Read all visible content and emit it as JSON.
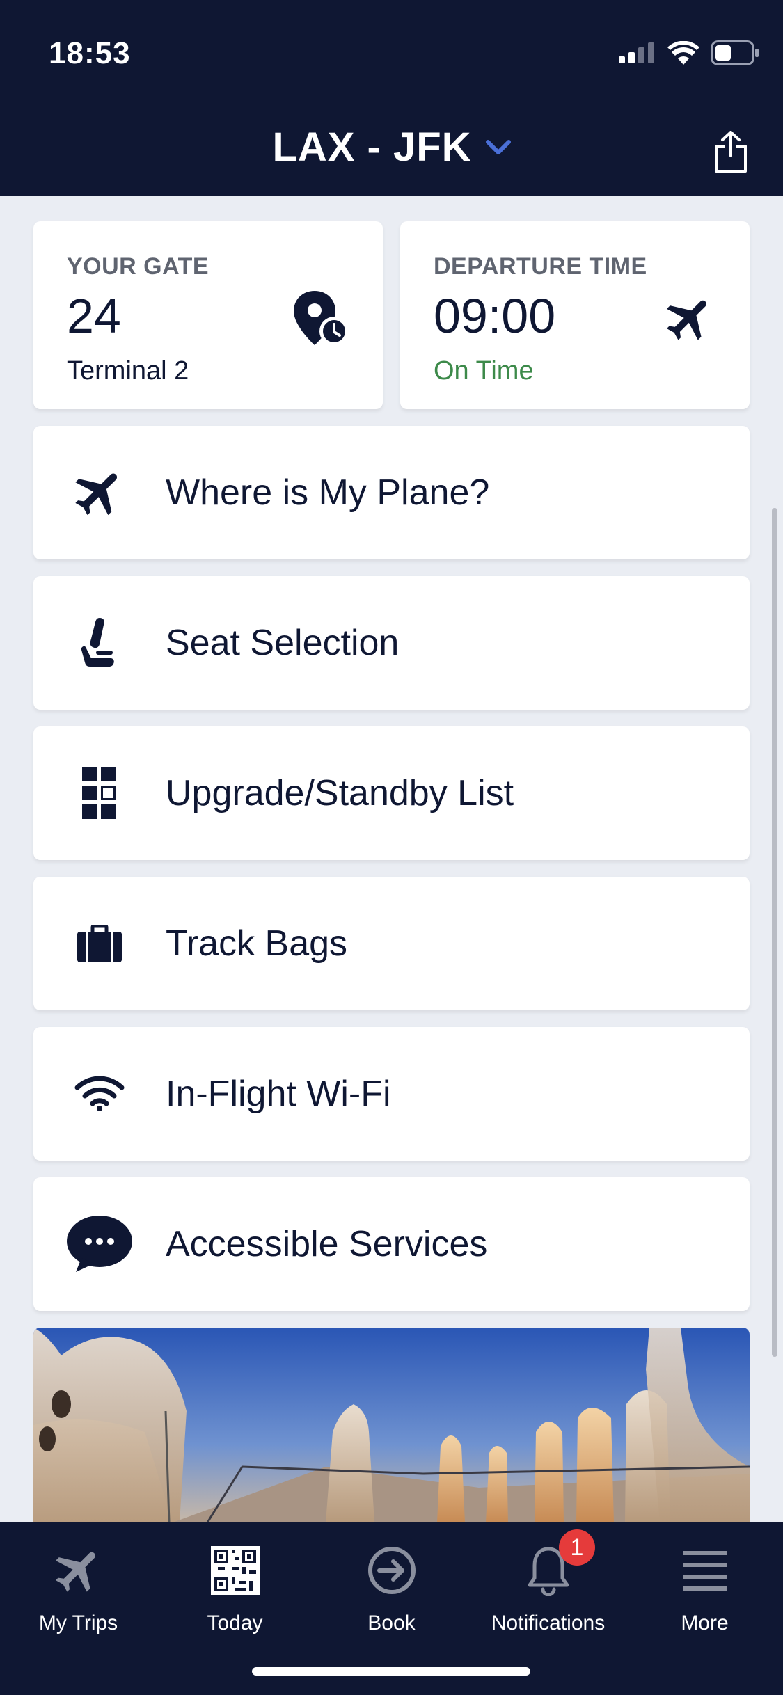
{
  "status_bar": {
    "time": "18:53"
  },
  "header": {
    "title": "LAX - JFK"
  },
  "gate_card": {
    "label": "YOUR GATE",
    "value": "24",
    "sub": "Terminal 2"
  },
  "departure_card": {
    "label": "DEPARTURE TIME",
    "value": "09:00",
    "status": "On Time",
    "status_color": "#3d8a4a"
  },
  "menu": [
    {
      "label": "Where is My Plane?",
      "icon": "plane-icon"
    },
    {
      "label": "Seat Selection",
      "icon": "seat-icon"
    },
    {
      "label": "Upgrade/Standby List",
      "icon": "list-grid-icon"
    },
    {
      "label": "Track Bags",
      "icon": "luggage-icon"
    },
    {
      "label": "In-Flight Wi-Fi",
      "icon": "wifi-icon"
    },
    {
      "label": "Accessible Services",
      "icon": "chat-bubble-icon"
    }
  ],
  "tabbar": [
    {
      "label": "My Trips",
      "icon": "plane-icon"
    },
    {
      "label": "Today",
      "icon": "qr-code-icon"
    },
    {
      "label": "Book",
      "icon": "arrow-circle-icon"
    },
    {
      "label": "Notifications",
      "icon": "bell-icon",
      "badge": "1"
    },
    {
      "label": "More",
      "icon": "hamburger-menu-icon"
    }
  ],
  "colors": {
    "navy": "#0f1733",
    "accent_blue": "#4a6fd8",
    "badge_red": "#e53b3b",
    "background": "#eaedf3"
  }
}
